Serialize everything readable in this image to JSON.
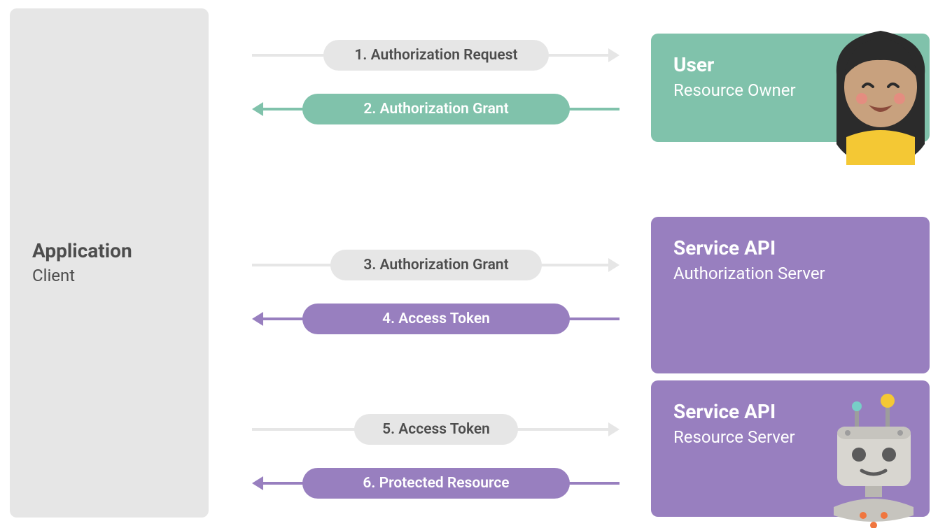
{
  "colors": {
    "grey": "#e6e6e6",
    "green": "#80c2ab",
    "purple": "#987fbf",
    "text_dark": "#4d4d4d",
    "text_light": "#ffffff"
  },
  "application": {
    "title": "Application",
    "subtitle": "Client"
  },
  "user": {
    "title": "User",
    "subtitle": "Resource Owner"
  },
  "auth_server": {
    "title": "Service API",
    "subtitle": "Authorization Server"
  },
  "resource_server": {
    "title": "Service API",
    "subtitle": "Resource Server"
  },
  "flows": {
    "step1": "1. Authorization Request",
    "step2": "2. Authorization Grant",
    "step3": "3. Authorization Grant",
    "step4": "4. Access Token",
    "step5": "5. Access Token",
    "step6": "6. Protected Resource"
  }
}
